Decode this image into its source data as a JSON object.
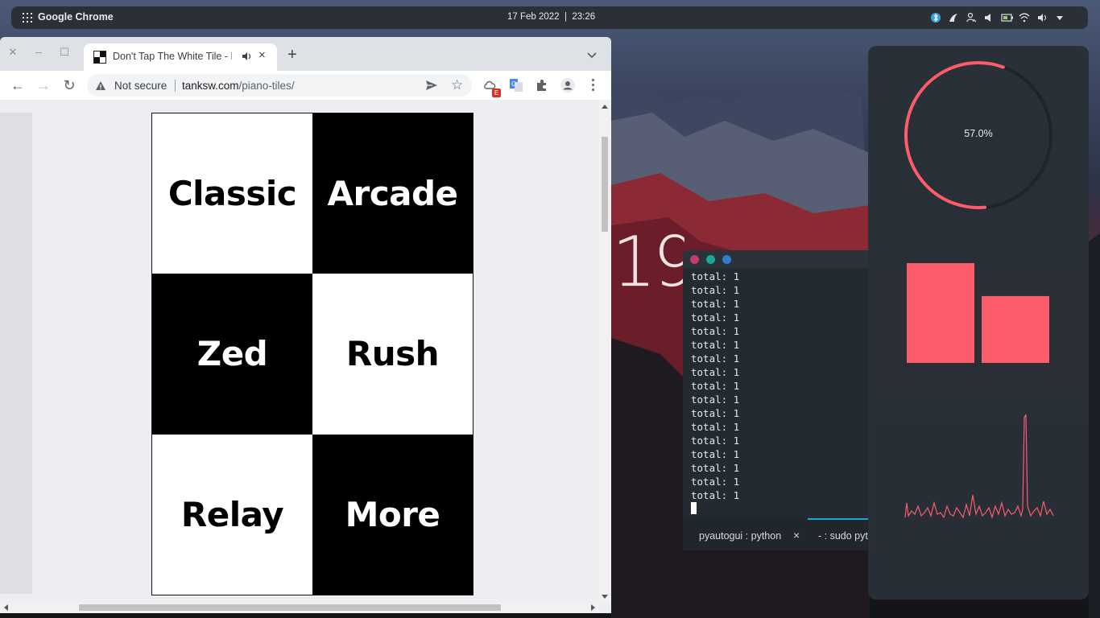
{
  "panel": {
    "app_name": "Google Chrome",
    "date": "17 Feb 2022",
    "time": "23:26",
    "tray_icons": [
      "bluetooth-icon",
      "nvidia-icon",
      "network-users-icon",
      "volume-icon",
      "battery-icon",
      "wifi-icon",
      "speaker-icon",
      "dropdown-arrow-icon"
    ]
  },
  "chrome": {
    "tab_title": "Don't Tap The White Tile - I",
    "tab_close": "×",
    "new_tab": "+",
    "back": "←",
    "forward": "→",
    "reload": "↻",
    "security_label": "Not secure",
    "url_host": "tanksw.com",
    "url_path": "/piano-tiles/",
    "star": "☆",
    "extension_badge": "E"
  },
  "game": {
    "tiles": [
      {
        "label": "Classic",
        "color": "#ffffff"
      },
      {
        "label": "Arcade",
        "color": "#000000"
      },
      {
        "label": "Zed",
        "color": "#000000"
      },
      {
        "label": "Rush",
        "color": "#ffffff"
      },
      {
        "label": "Relay",
        "color": "#ffffff"
      },
      {
        "label": "More",
        "color": "#000000"
      }
    ]
  },
  "wallpaper": {
    "clock_fragment": "19"
  },
  "terminal": {
    "lines": [
      "total: 1",
      "total: 1",
      "total: 1",
      "total: 1",
      "total: 1",
      "total: 1",
      "total: 1",
      "total: 1",
      "total: 1",
      "total: 1",
      "total: 1",
      "total: 1",
      "total: 1",
      "total: 1",
      "total: 1",
      "total: 1",
      "total: 1"
    ],
    "tabs": [
      {
        "label": "pyautogui : python"
      },
      {
        "label": "- : sudo pyt"
      }
    ],
    "close_glyph": "×",
    "dot_colors": [
      "#c83a6a",
      "#1aa890",
      "#2f7fd0"
    ]
  },
  "monitor": {
    "gauge_label": "57.0%",
    "gauge_fraction": 0.57,
    "bar_levels": [
      1.0,
      0.67
    ],
    "accent": "#fc5c6c"
  }
}
